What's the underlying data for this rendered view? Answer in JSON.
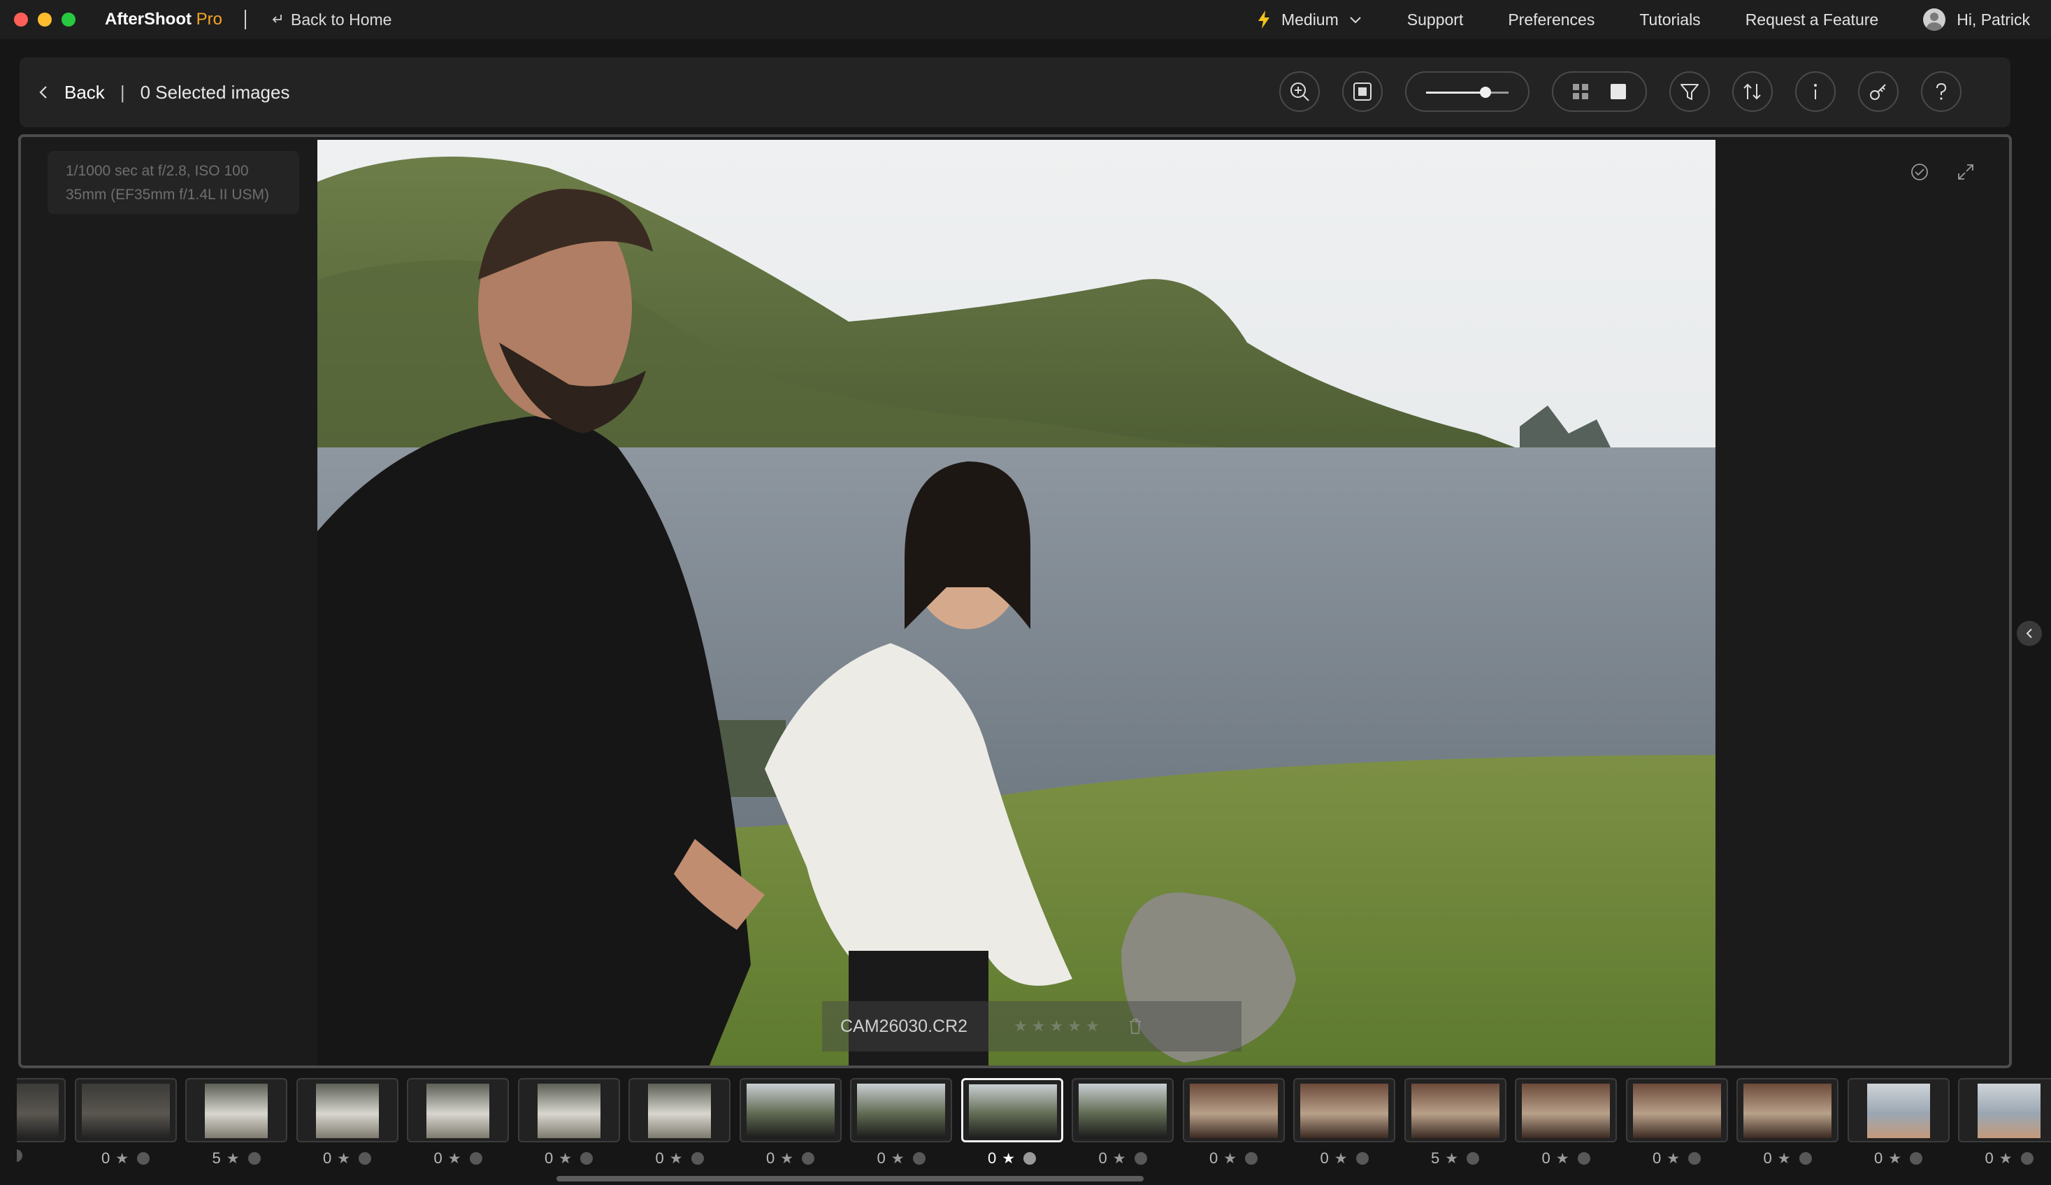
{
  "titlebar": {
    "app_name": "AfterShoot",
    "app_badge": "Pro",
    "back_home": "Back to Home",
    "mode": "Medium",
    "support": "Support",
    "preferences": "Preferences",
    "tutorials": "Tutorials",
    "request_feature": "Request a Feature",
    "greeting": "Hi, Patrick"
  },
  "toolbar": {
    "back_label": "Back",
    "separator": "|",
    "selected_text": "0 Selected images",
    "zoom_level": 0.7,
    "tools": [
      "zoom-in-icon",
      "fit-screen-icon",
      "zoom-slider",
      "grid-view-icon",
      "single-view-icon",
      "filter-icon",
      "sort-icon",
      "info-icon",
      "key-icon",
      "help-icon"
    ]
  },
  "viewer": {
    "exif_line1": "1/1000 sec at f/2.8, ISO 100",
    "exif_line2": "35mm (EF35mm f/1.4L II USM)",
    "filename": "CAM26030.CR2",
    "star_rating_placeholder": "★★★★★"
  },
  "filmstrip": {
    "thumbnails": [
      {
        "rating": "",
        "kind": "group"
      },
      {
        "rating": "0",
        "kind": "group"
      },
      {
        "rating": "5",
        "kind": "portrait"
      },
      {
        "rating": "0",
        "kind": "portrait"
      },
      {
        "rating": "0",
        "kind": "portrait"
      },
      {
        "rating": "0",
        "kind": "portrait"
      },
      {
        "rating": "0",
        "kind": "portrait"
      },
      {
        "rating": "0",
        "kind": "coast"
      },
      {
        "rating": "0",
        "kind": "coast"
      },
      {
        "rating": "0",
        "kind": "coast",
        "active": true
      },
      {
        "rating": "0",
        "kind": "coast"
      },
      {
        "rating": "0",
        "kind": "interior"
      },
      {
        "rating": "0",
        "kind": "interior"
      },
      {
        "rating": "5",
        "kind": "interior"
      },
      {
        "rating": "0",
        "kind": "interior"
      },
      {
        "rating": "0",
        "kind": "interior"
      },
      {
        "rating": "0",
        "kind": "interior"
      },
      {
        "rating": "0",
        "kind": "bright"
      },
      {
        "rating": "0",
        "kind": "bright"
      }
    ]
  },
  "colors": {
    "accent_pro": "#f5a524",
    "background": "#161616",
    "panel": "#232323"
  }
}
